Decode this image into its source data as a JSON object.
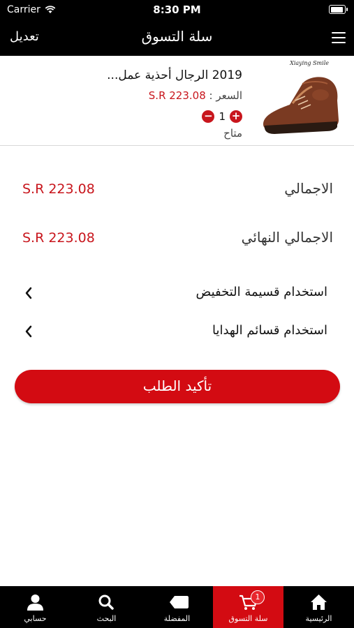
{
  "status": {
    "carrier": "Carrier",
    "time": "8:30 PM"
  },
  "nav": {
    "title": "سلة التسوق",
    "edit_label": "تعديل"
  },
  "cart_item": {
    "brand": "Xiaying Smile",
    "name": "2019 الرجال أحذية عمل...",
    "price_label": "السعر :",
    "price_value": "S.R 223.08",
    "quantity": "1",
    "availability": "متاح"
  },
  "summary": {
    "total_label": "الاجمالي",
    "total_value": "S.R 223.08",
    "final_label": "الاجمالي النهائي",
    "final_value": "S.R 223.08"
  },
  "options": {
    "discount_coupon": "استخدام قسيمة التخفيض",
    "gift_cards": "استخدام قسائم الهدايا"
  },
  "confirm_label": "تأكيد الطلب",
  "tabbar": {
    "home": "الرئيسية",
    "cart": "سلة التسوق",
    "cart_badge": "1",
    "favorites": "المفضلة",
    "search": "البحث",
    "account": "حسابي"
  },
  "colors": {
    "accent": "#d30b12",
    "price": "#c8161d",
    "bar": "#000000"
  }
}
